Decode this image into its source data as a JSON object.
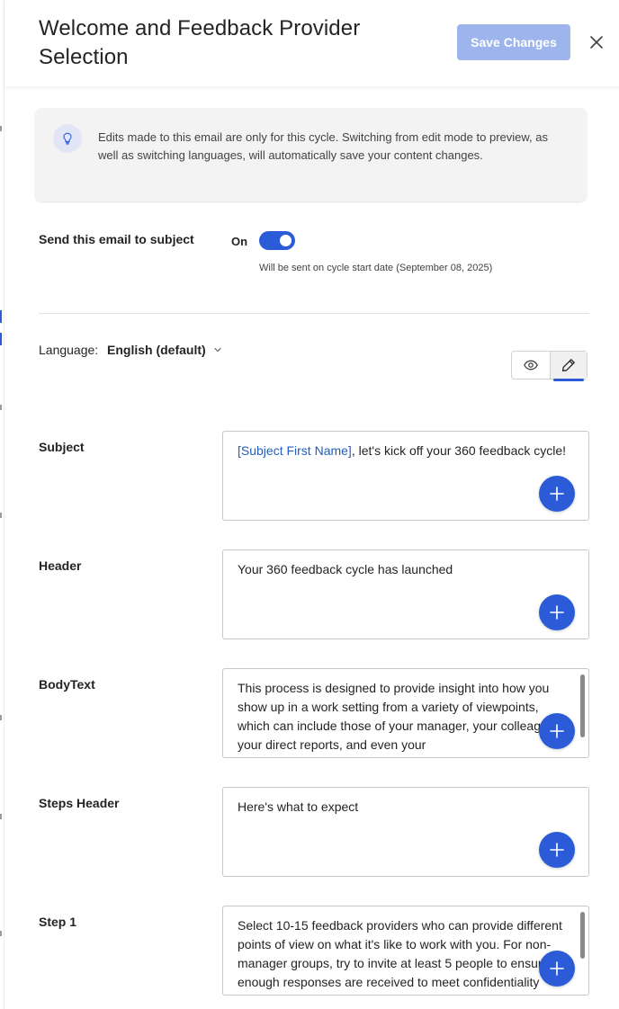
{
  "header": {
    "title": "Welcome and Feedback Provider Selection",
    "save_label": "Save Changes",
    "close_icon": "close-icon"
  },
  "notice": {
    "icon": "lightbulb-icon",
    "text": "Edits made to this email are only for this cycle. Switching from edit mode to preview, as well as switching languages, will automatically save your content changes."
  },
  "send": {
    "label": "Send this email to subject",
    "state_label": "On",
    "enabled": true,
    "note": "Will be sent on cycle start date (September 08, 2025)"
  },
  "language": {
    "label": "Language:",
    "value": "English (default)",
    "chevron_icon": "chevron-down-icon"
  },
  "view_mode": {
    "options": [
      "preview",
      "edit"
    ],
    "selected": "edit",
    "preview_icon": "eye-icon",
    "edit_icon": "pencil-icon"
  },
  "fields": [
    {
      "label": "Subject",
      "token": "[Subject First Name]",
      "text": ", let's kick off your 360 feedback cycle!"
    },
    {
      "label": "Header",
      "text": "Your 360 feedback cycle has launched"
    },
    {
      "label": "BodyText",
      "text": "This process is designed to provide insight into how you show up in a work setting from a variety of viewpoints, which can include those of your manager, your colleagues, your direct reports, and even your"
    },
    {
      "label": "Steps Header",
      "text": "Here's what to expect"
    },
    {
      "label": "Step 1",
      "text": "Select 10-15 feedback providers who can provide different points of view on what it's like to work with you. For non-manager groups, try to invite at least 5 people to ensure enough responses are received to meet confidentiality requirements for your report."
    }
  ],
  "colors": {
    "accent": "#2b5bd7",
    "save_disabled": "#9db4ec",
    "token": "#1f5fc1"
  }
}
